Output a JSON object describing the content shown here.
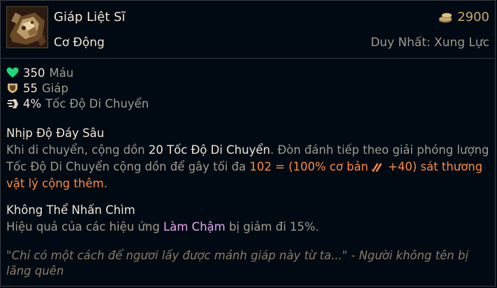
{
  "item": {
    "name": "Giáp Liệt Sĩ",
    "type": "Cơ Động",
    "cost": "2900",
    "unique_label": "Duy Nhất: Xung Lực",
    "icon": "martyr-armor-icon"
  },
  "stats": [
    {
      "icon": "heart-icon",
      "value": "350",
      "label": "Máu"
    },
    {
      "icon": "shield-icon",
      "value": "55",
      "label": "Giáp"
    },
    {
      "icon": "boot-icon",
      "value": "4%",
      "label": "Tốc Độ Di Chuyển"
    }
  ],
  "passive1": {
    "title": "Nhịp Độ Đáy Sâu",
    "t1": "Khi di chuyển, cộng dồn ",
    "t2": "20 Tốc Độ Di Chuyển",
    "t3": ". Đòn đánh tiếp theo giải phóng lượng Tốc Độ Di Chuyển cộng dồn để gây tối đa ",
    "t4": "102 = (100% cơ bản",
    "t5": " +40) sát thương vật lý cộng thêm",
    "t6": "."
  },
  "passive2": {
    "title": "Không Thể Nhấn Chìm",
    "t1": "Hiệu quả của các hiệu ứng ",
    "t2": "Làm Chậm",
    "t3": " bị giảm đi 15%."
  },
  "quote": "\"Chỉ có một cách để ngươi lấy được mảnh giáp này từ ta...\" - Người không tên bị lãng quên",
  "colors": {
    "background": "#010a13",
    "title": "#f0e6d2",
    "gold": "#c8aa6e",
    "body": "#a09b8c",
    "damage": "#ff8a3c",
    "slow": "#e4a4f2",
    "health": "#1ed87a",
    "lore": "#8a7c60"
  }
}
